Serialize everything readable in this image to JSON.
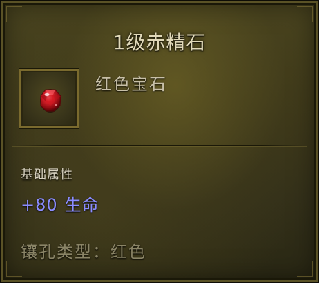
{
  "item": {
    "name": "1级赤精石",
    "subtype": "红色宝石",
    "icon": "red-gem-icon"
  },
  "attributes": {
    "header": "基础属性",
    "bonus_value": "+80",
    "bonus_stat": "生命"
  },
  "socket": {
    "label": "镶孔类型：",
    "value": "红色"
  },
  "colors": {
    "title": "#e0d8b8",
    "stat_bonus": "#8a8cff",
    "socket_text": "#8a8466",
    "gem": "#c8141e"
  }
}
